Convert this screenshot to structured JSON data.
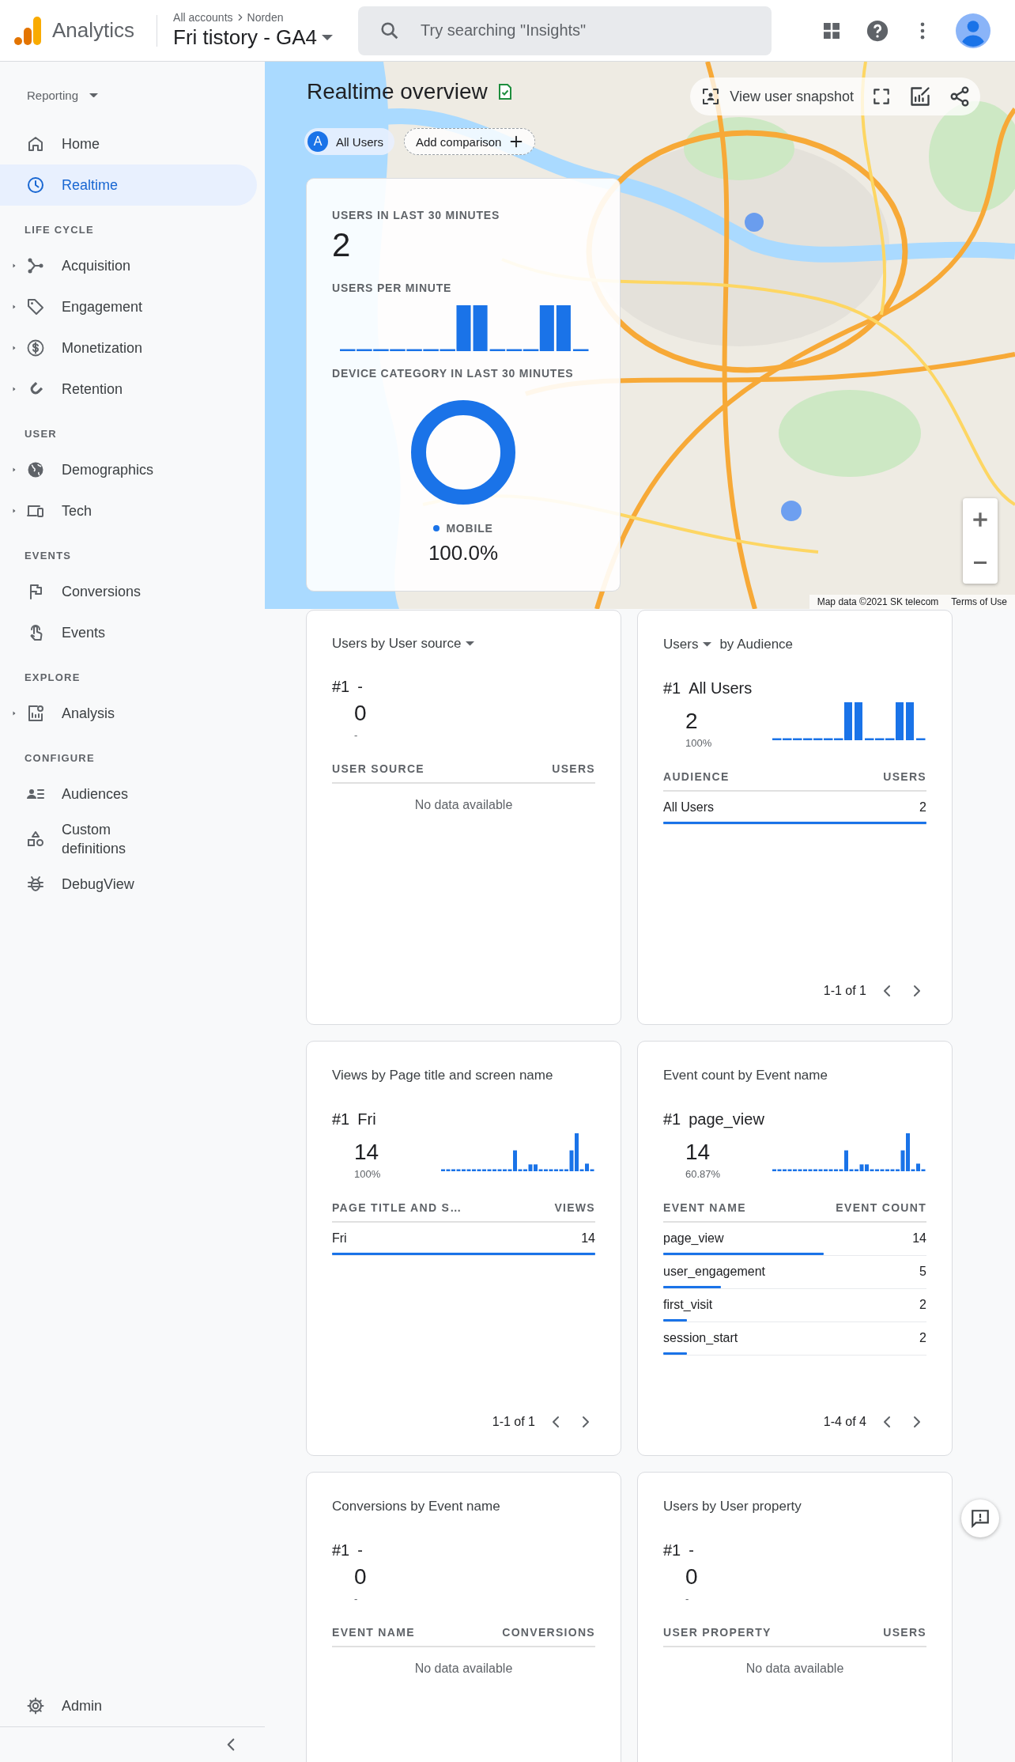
{
  "header": {
    "product": "Analytics",
    "breadcrumb": [
      {
        "label": "All accounts"
      },
      {
        "label": "Norden"
      }
    ],
    "property": "Fri tistory - GA4",
    "search": {
      "placeholder": "Try searching \"Insights\""
    }
  },
  "sidebar": {
    "reporting": "Reporting",
    "groups": [
      {
        "items": [
          {
            "label": "Home",
            "expandable": false,
            "selected": false
          },
          {
            "label": "Realtime",
            "expandable": false,
            "selected": true
          }
        ]
      },
      {
        "heading": "LIFE CYCLE",
        "items": [
          {
            "label": "Acquisition",
            "expandable": true,
            "selected": false
          },
          {
            "label": "Engagement",
            "expandable": true,
            "selected": false
          },
          {
            "label": "Monetization",
            "expandable": true,
            "selected": false
          },
          {
            "label": "Retention",
            "expandable": true,
            "selected": false
          }
        ]
      },
      {
        "heading": "USER",
        "items": [
          {
            "label": "Demographics",
            "expandable": true,
            "selected": false
          },
          {
            "label": "Tech",
            "expandable": true,
            "selected": false
          }
        ]
      },
      {
        "heading": "EVENTS",
        "items": [
          {
            "label": "Conversions",
            "expandable": false,
            "selected": false
          },
          {
            "label": "Events",
            "expandable": false,
            "selected": false
          }
        ]
      },
      {
        "heading": "EXPLORE",
        "items": [
          {
            "label": "Analysis",
            "expandable": true,
            "selected": false
          }
        ]
      },
      {
        "heading": "CONFIGURE",
        "items": [
          {
            "label": "Audiences",
            "expandable": false,
            "selected": false
          },
          {
            "label": "Custom definitions",
            "expandable": false,
            "selected": false
          },
          {
            "label": "DebugView",
            "expandable": false,
            "selected": false
          }
        ]
      }
    ],
    "admin": "Admin"
  },
  "realtime": {
    "title": "Realtime overview",
    "comparisons": [
      {
        "badge": "A",
        "label": "All Users"
      }
    ],
    "add_comparison": "Add comparison",
    "snapshot": "View user snapshot",
    "summary": {
      "users_label": "USERS IN LAST 30 MINUTES",
      "users_value": "2",
      "per_minute_label": "USERS PER MINUTE",
      "device_label": "DEVICE CATEGORY IN LAST 30 MINUTES",
      "legend": [
        {
          "label": "MOBILE",
          "value": "100.0%",
          "color": "#1a73e8"
        }
      ]
    },
    "attribution": "Map data ©2021 SK telecom",
    "terms": "Terms of Use"
  },
  "cards": [
    {
      "title": [
        {
          "text": "Users by User source",
          "dropdown": true
        }
      ],
      "rank": "#1",
      "top": "-",
      "value": "0",
      "share": "-",
      "sparkline": false,
      "columns": [
        "USER SOURCE",
        "USERS"
      ],
      "empty": "No data available"
    },
    {
      "title": [
        {
          "text": "Users",
          "dropdown": true
        },
        {
          "text": "by Audience",
          "dropdown": false
        }
      ],
      "rank": "#1",
      "top": "All Users",
      "value": "2",
      "share": "100%",
      "sparkline": true,
      "columns": [
        "AUDIENCE",
        "USERS"
      ],
      "rows": [
        {
          "label": "All Users",
          "value": "2",
          "level": 1
        }
      ],
      "pagination": "1-1 of 1"
    },
    {
      "title": [
        {
          "text": "Views by Page title and screen name",
          "dropdown": false
        }
      ],
      "rank": "#1",
      "top": "Fri",
      "value": "14",
      "share": "100%",
      "sparkline": true,
      "columns": [
        "PAGE TITLE AND S…",
        "VIEWS"
      ],
      "rows": [
        {
          "label": "Fri",
          "value": "14",
          "level": 1
        }
      ],
      "pagination": "1-1 of 1"
    },
    {
      "title": [
        {
          "text": "Event count by Event name",
          "dropdown": false
        }
      ],
      "rank": "#1",
      "top": "page_view",
      "value": "14",
      "share": "60.87%",
      "sparkline": true,
      "columns": [
        "EVENT NAME",
        "EVENT COUNT"
      ],
      "rows": [
        {
          "label": "page_view",
          "value": "14",
          "level": 0.61
        },
        {
          "label": "user_engagement",
          "value": "5",
          "level": 0.22
        },
        {
          "label": "first_visit",
          "value": "2",
          "level": 0.09
        },
        {
          "label": "session_start",
          "value": "2",
          "level": 0.09
        }
      ],
      "pagination": "1-4 of 4"
    },
    {
      "title": [
        {
          "text": "Conversions by Event name",
          "dropdown": false
        }
      ],
      "rank": "#1",
      "top": "-",
      "value": "0",
      "share": "-",
      "sparkline": false,
      "columns": [
        "EVENT NAME",
        "CONVERSIONS"
      ],
      "empty": "No data available"
    },
    {
      "title": [
        {
          "text": "Users by User property",
          "dropdown": false
        }
      ],
      "rank": "#1",
      "top": "-",
      "value": "0",
      "share": "-",
      "sparkline": false,
      "columns": [
        "USER PROPERTY",
        "USERS"
      ],
      "empty": "No data available"
    }
  ]
}
